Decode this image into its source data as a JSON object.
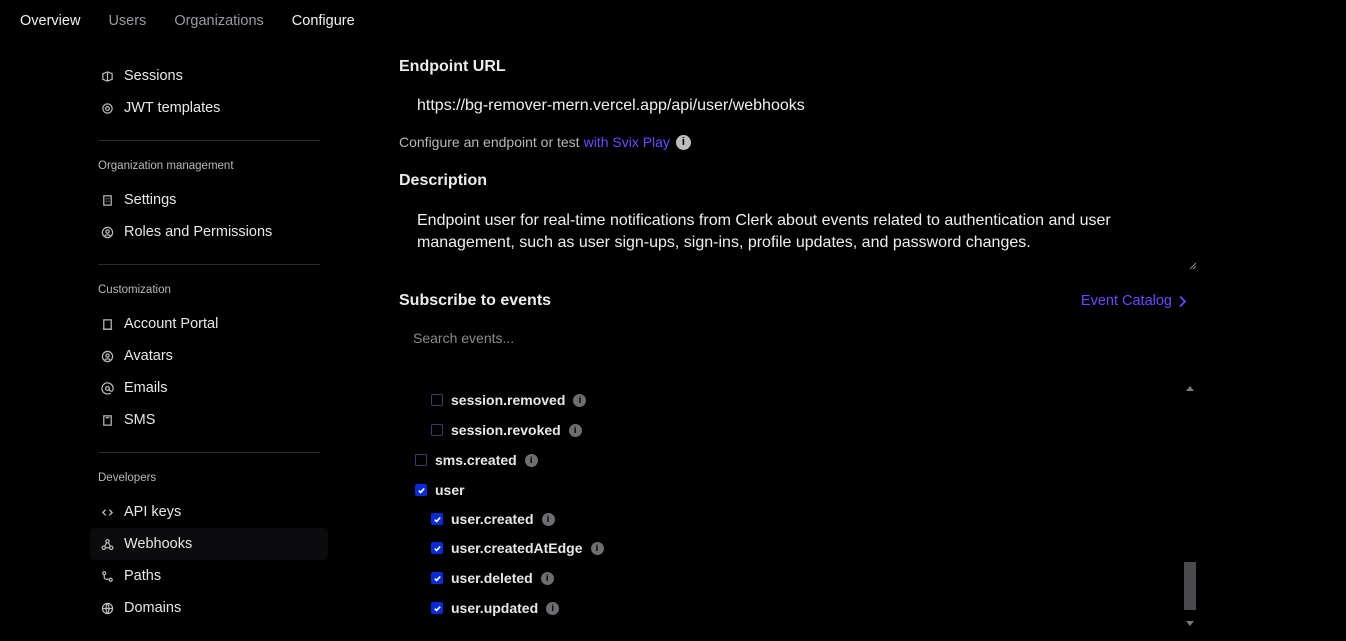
{
  "topnav": {
    "items": [
      {
        "label": "Overview",
        "active": true
      },
      {
        "label": "Users",
        "active": false
      },
      {
        "label": "Organizations",
        "active": false
      },
      {
        "label": "Configure",
        "active": true
      }
    ]
  },
  "sidebar": {
    "items_top": [
      {
        "label": "Sessions",
        "icon": "sessions-icon"
      },
      {
        "label": "JWT templates",
        "icon": "jwt-icon"
      }
    ],
    "org_heading": "Organization management",
    "org_items": [
      {
        "label": "Settings",
        "icon": "building-icon"
      },
      {
        "label": "Roles and Permissions",
        "icon": "user-circle-icon"
      }
    ],
    "custom_heading": "Customization",
    "custom_items": [
      {
        "label": "Account Portal",
        "icon": "portal-icon"
      },
      {
        "label": "Avatars",
        "icon": "avatar-icon"
      },
      {
        "label": "Emails",
        "icon": "at-icon"
      },
      {
        "label": "SMS",
        "icon": "phone-icon"
      }
    ],
    "dev_heading": "Developers",
    "dev_items": [
      {
        "label": "API keys",
        "icon": "code-icon"
      },
      {
        "label": "Webhooks",
        "icon": "webhook-icon",
        "active": true
      },
      {
        "label": "Paths",
        "icon": "paths-icon"
      },
      {
        "label": "Domains",
        "icon": "globe-icon"
      }
    ]
  },
  "endpoint": {
    "label": "Endpoint URL",
    "url": "https://bg-remover-mern.vercel.app/api/user/webhooks",
    "hint_prefix": "Configure an endpoint or test",
    "hint_link": "with Svix Play"
  },
  "description": {
    "label": "Description",
    "line1": "Endpoint user for real-time notifications from Clerk about events related to authentication and user",
    "line2": "management, such as user sign-ups, sign-ins, profile updates, and password changes."
  },
  "subscribe": {
    "label": "Subscribe to events",
    "catalog_link": "Event Catalog",
    "search_placeholder": "Search events..."
  },
  "events": [
    {
      "label": "session.removed",
      "checked": false,
      "indent": true
    },
    {
      "label": "session.revoked",
      "checked": false,
      "indent": true
    },
    {
      "label": "sms.created",
      "checked": false,
      "indent": false
    },
    {
      "label": "user",
      "checked": true,
      "indent": false,
      "group": true
    },
    {
      "label": "user.created",
      "checked": true,
      "indent": true
    },
    {
      "label": "user.createdAtEdge",
      "checked": true,
      "indent": true
    },
    {
      "label": "user.deleted",
      "checked": true,
      "indent": true
    },
    {
      "label": "user.updated",
      "checked": true,
      "indent": true
    }
  ],
  "colors": {
    "accent": "#6c47ff",
    "checkbox": "#0b2bd6",
    "background": "#000000"
  }
}
